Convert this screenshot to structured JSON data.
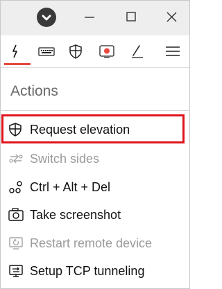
{
  "window": {
    "logo_icon": "anydesk-logo-icon",
    "controls": {
      "minimize_icon": "minimize-icon",
      "maximize_icon": "maximize-icon",
      "close_icon": "close-icon"
    }
  },
  "toolbar": {
    "items": [
      {
        "icon": "lightning-icon",
        "active": true
      },
      {
        "icon": "keyboard-icon",
        "active": false
      },
      {
        "icon": "shield-icon",
        "active": false
      },
      {
        "icon": "record-icon",
        "active": false
      },
      {
        "icon": "pen-icon",
        "active": false
      },
      {
        "icon": "hamburger-menu-icon",
        "active": false
      }
    ],
    "active_color": "#e8483f"
  },
  "actions_panel": {
    "heading": "Actions",
    "highlight_color": "#e0141b",
    "items": [
      {
        "label": "Request elevation",
        "icon": "shield-icon",
        "enabled": true,
        "highlighted": true
      },
      {
        "label": "Switch sides",
        "icon": "switch-sides-icon",
        "enabled": false,
        "highlighted": false
      },
      {
        "label": "Ctrl + Alt + Del",
        "icon": "key-combo-icon",
        "enabled": true,
        "highlighted": false
      },
      {
        "label": "Take screenshot",
        "icon": "camera-icon",
        "enabled": true,
        "highlighted": false
      },
      {
        "label": "Restart remote device",
        "icon": "restart-device-icon",
        "enabled": false,
        "highlighted": false
      },
      {
        "label": "Setup TCP tunneling",
        "icon": "tcp-tunnel-icon",
        "enabled": true,
        "highlighted": false
      }
    ]
  }
}
